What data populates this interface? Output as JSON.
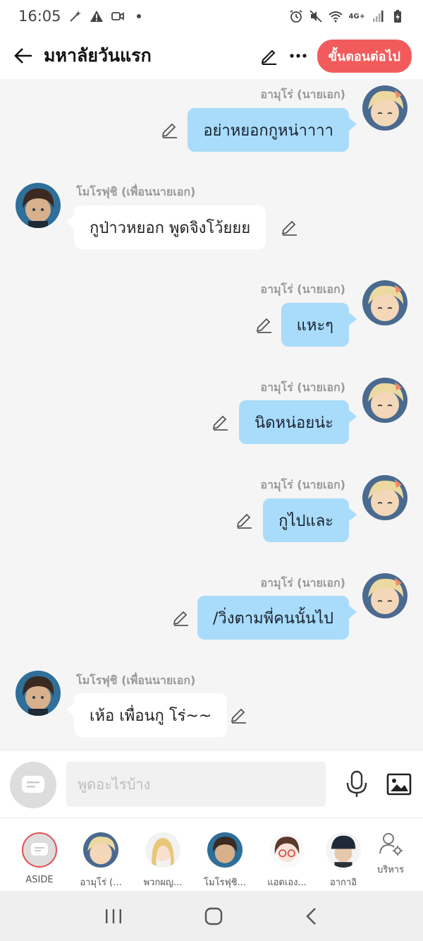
{
  "status_bar": {
    "time": "16:05",
    "network_label": "4G+"
  },
  "header": {
    "title": "มหาลัยวันแรก",
    "next_button": "ขั้นตอนต่อไป"
  },
  "colors": {
    "accent": "#f25b5b",
    "bubble_right": "#a8dcfa",
    "bubble_left": "#ffffff"
  },
  "messages": [
    {
      "side": "right",
      "sender": "อามุโร่ (นายเอก)",
      "text": "อย่าหยอกกูหน่าาาา"
    },
    {
      "side": "left",
      "sender": "โมโรฟุชิ (เพื่อนนายเอก)",
      "text": "กูป่าวหยอก พูดจิงโว้ยยย"
    },
    {
      "side": "right",
      "sender": "อามุโร่ (นายเอก)",
      "text": "แหะๆ"
    },
    {
      "side": "right",
      "sender": "อามุโร่ (นายเอก)",
      "text": "นิดหน่อยน่ะ"
    },
    {
      "side": "right",
      "sender": "อามุโร่ (นายเอก)",
      "text": "กูไปและ"
    },
    {
      "side": "right",
      "sender": "อามุโร่ (นายเอก)",
      "text": "/วิ่งตามพี่คนนั้นไป"
    },
    {
      "side": "left",
      "sender": "โมโรฟุชิ (เพื่อนนายเอก)",
      "text": "เห้อ เพื่อนกู โร่~~"
    }
  ],
  "input": {
    "placeholder": "พูดอะไรบ้าง"
  },
  "characters": [
    {
      "name": "ASIDE",
      "icon": "aside-icon"
    },
    {
      "name": "อามุโร่ (...",
      "icon": "avatar-amuro"
    },
    {
      "name": "พวกผญ...",
      "icon": "avatar-girls"
    },
    {
      "name": "โมโรฟุชิ...",
      "icon": "avatar-morofushi"
    },
    {
      "name": "แอดเอง...",
      "icon": "avatar-admin"
    },
    {
      "name": "อากาอิ",
      "icon": "avatar-akai"
    }
  ],
  "manage_label": "บริหาร"
}
